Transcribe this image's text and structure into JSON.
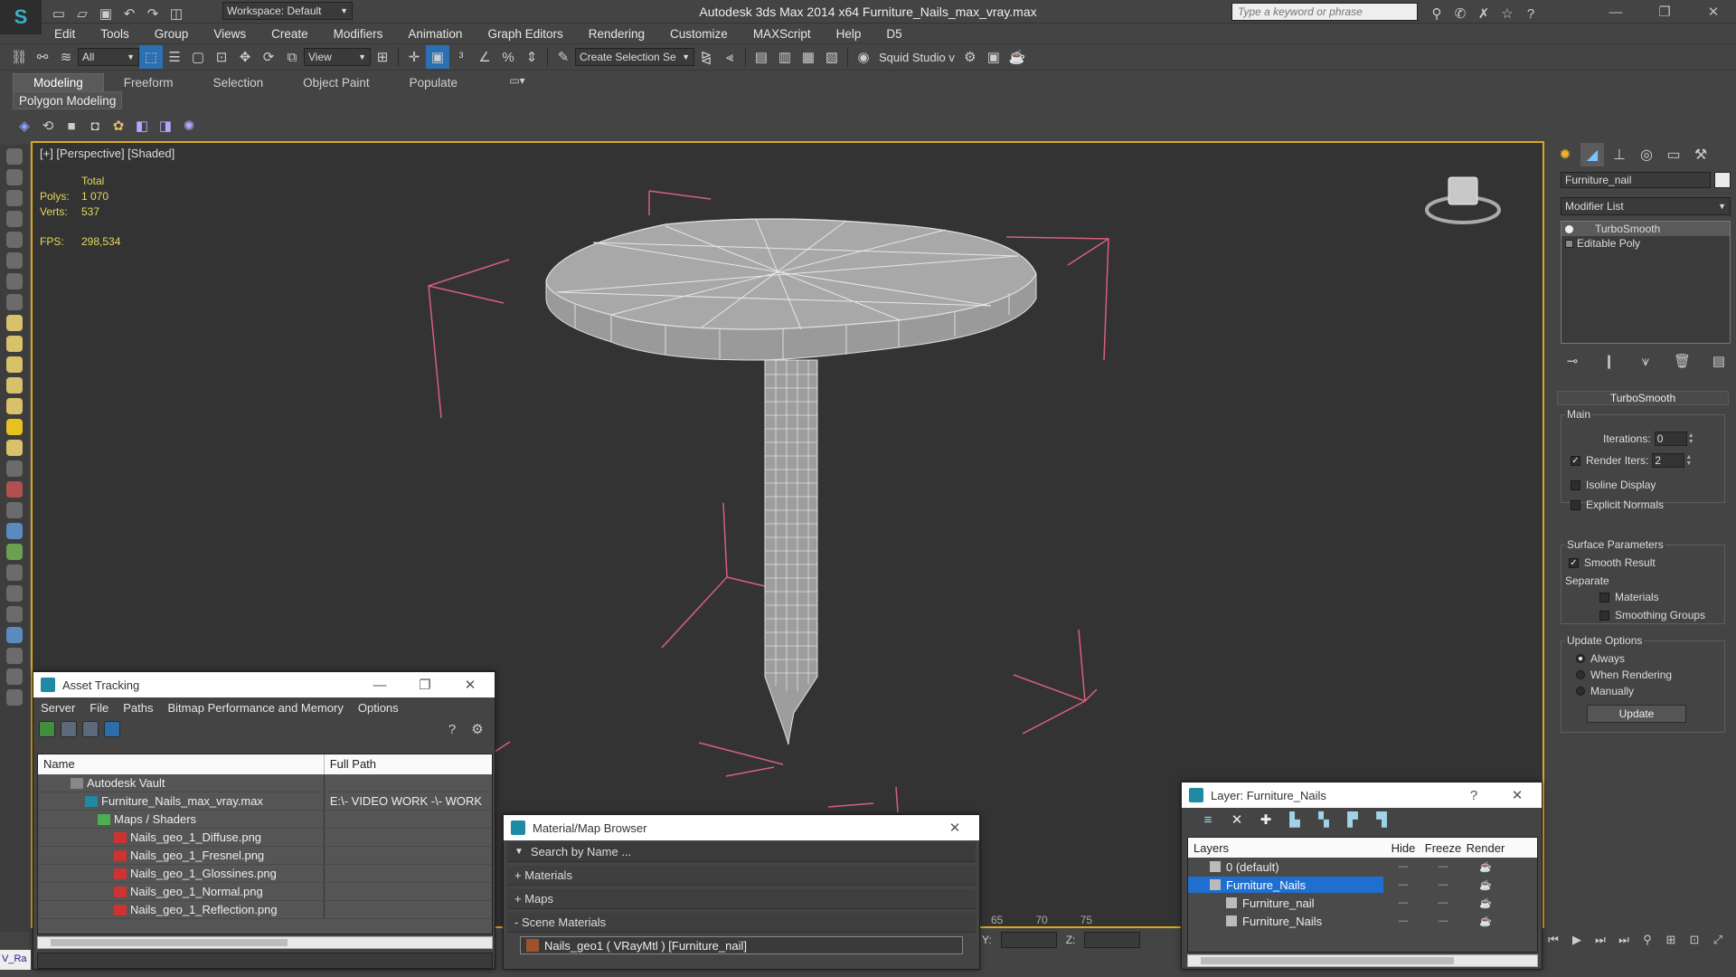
{
  "app": {
    "logo": "S",
    "title": "Autodesk 3ds Max  2014 x64      Furniture_Nails_max_vray.max",
    "workspace": "Workspace: Default",
    "search_placeholder": "Type a keyword or phrase",
    "win_min": "—",
    "win_max": "❐",
    "win_close": "✕"
  },
  "menu": [
    "Edit",
    "Tools",
    "Group",
    "Views",
    "Create",
    "Modifiers",
    "Animation",
    "Graph Editors",
    "Rendering",
    "Customize",
    "MAXScript",
    "Help",
    "D5"
  ],
  "toolbar": {
    "selection_filter": "All",
    "ref_coord": "View",
    "named_selection": "Create Selection Se",
    "squid_label": "Squid Studio v"
  },
  "ribbon": {
    "tabs": [
      "Modeling",
      "Freeform",
      "Selection",
      "Object Paint",
      "Populate"
    ],
    "active_tab": "Modeling",
    "panel_label": "Polygon Modeling"
  },
  "viewport": {
    "label": "[+] [Perspective] [Shaded]",
    "stats": {
      "total_label": "Total",
      "polys_label": "Polys:",
      "polys": "1 070",
      "verts_label": "Verts:",
      "verts": "537",
      "fps_label": "FPS:",
      "fps": "298,534"
    },
    "timeline_ticks": [
      "65",
      "70",
      "75"
    ]
  },
  "command_panel": {
    "object_name": "Furniture_nail",
    "modifier_list": "Modifier List",
    "stack": [
      "TurboSmooth",
      "Editable Poly"
    ],
    "rollout_title": "TurboSmooth",
    "main": {
      "title": "Main",
      "iterations_label": "Iterations:",
      "iterations": "0",
      "render_iters_label": "Render Iters:",
      "render_iters": "2",
      "isoline_label": "Isoline Display",
      "explicit_normals_label": "Explicit Normals"
    },
    "surface": {
      "title": "Surface Parameters",
      "smooth_result_label": "Smooth Result",
      "separate_label": "Separate",
      "materials_label": "Materials",
      "smoothing_groups_label": "Smoothing Groups"
    },
    "update": {
      "title": "Update Options",
      "always": "Always",
      "when_rendering": "When Rendering",
      "manually": "Manually",
      "button": "Update"
    }
  },
  "asset_tracking": {
    "title": "Asset Tracking",
    "menu": [
      "Server",
      "File",
      "Paths",
      "Bitmap Performance and Memory",
      "Options"
    ],
    "columns": [
      "Name",
      "Full Path"
    ],
    "rows": [
      {
        "name": "Autodesk Vault",
        "path": ""
      },
      {
        "name": "Furniture_Nails_max_vray.max",
        "path": "E:\\- VIDEO WORK -\\- WORK"
      },
      {
        "name": "Maps / Shaders",
        "path": ""
      },
      {
        "name": "Nails_geo_1_Diffuse.png",
        "path": ""
      },
      {
        "name": "Nails_geo_1_Fresnel.png",
        "path": ""
      },
      {
        "name": "Nails_geo_1_Glossines.png",
        "path": ""
      },
      {
        "name": "Nails_geo_1_Normal.png",
        "path": ""
      },
      {
        "name": "Nails_geo_1_Reflection.png",
        "path": ""
      }
    ]
  },
  "material_browser": {
    "title": "Material/Map Browser",
    "search_placeholder": "Search by Name ...",
    "groups": [
      "+ Materials",
      "+ Maps",
      "- Scene Materials"
    ],
    "scene_item": "Nails_geo1  ( VRayMtl ) [Furniture_nail]"
  },
  "layer_window": {
    "title": "Layer: Furniture_Nails",
    "help": "?",
    "columns": [
      "Layers",
      "Hide",
      "Freeze",
      "Render"
    ],
    "rows": [
      {
        "name": "0 (default)",
        "selected": false
      },
      {
        "name": "Furniture_Nails",
        "selected": true
      },
      {
        "name": "Furniture_nail",
        "selected": false
      },
      {
        "name": "Furniture_Nails",
        "selected": false
      }
    ],
    "dash": "—"
  },
  "status": {
    "y_label": "Y:",
    "z_label": "Z:",
    "maxscript_label": "V_Ra"
  },
  "colors": {
    "viewport_border": "#d9a820",
    "stats_text": "#e6d95a",
    "selection_blue": "#1f6fd1",
    "gizmo_red": "#d8607a"
  }
}
